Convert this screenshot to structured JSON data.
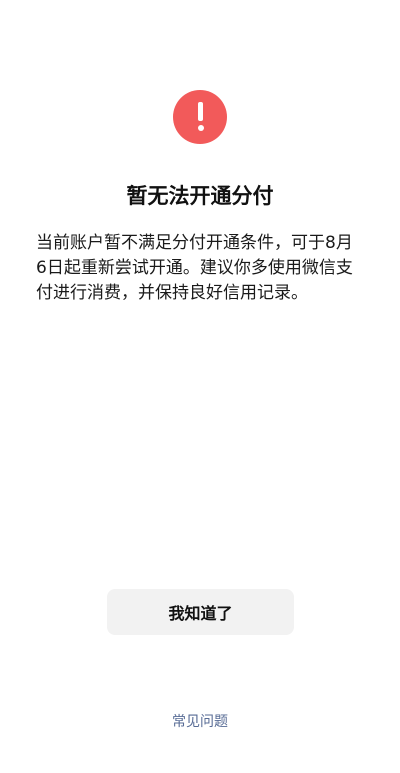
{
  "dialog": {
    "title": "暂无法开通分付",
    "message_lines": [
      "当前账户暂不满足分付开通条件，可于8月",
      "6日起重新尝试开通。建议你多使用微信支",
      "付进行消费，并保持良好信用记录。"
    ],
    "icon": "alert-icon",
    "accent_color": "#f25a5a"
  },
  "actions": {
    "ack_label": "我知道了",
    "faq_label": "常见问题",
    "link_color": "#576b95"
  }
}
